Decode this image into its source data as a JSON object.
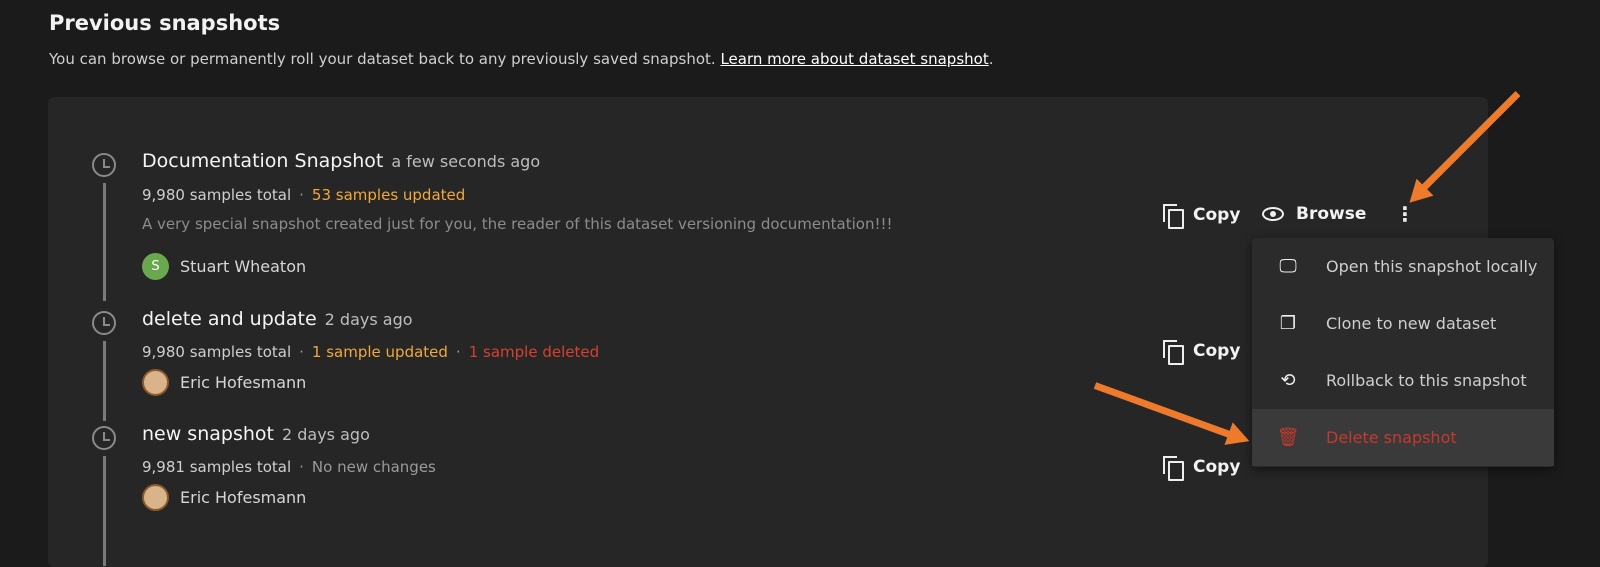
{
  "header": {
    "title": "Previous snapshots",
    "description": "You can browse or permanently roll your dataset back to any previously saved snapshot. ",
    "link": "Learn more about dataset snapshot",
    "period": "."
  },
  "snapshots": [
    {
      "name": "Documentation Snapshot",
      "ago": "a few seconds ago",
      "total": "9,980 samples total",
      "updated": "53 samples updated",
      "description": "A very special snapshot created just for you, the reader of this dataset versioning documentation!!!",
      "user": "Stuart Wheaton",
      "avatar_letter": "S"
    },
    {
      "name": "delete and update",
      "ago": "2 days ago",
      "total": "9,980 samples total",
      "updated": "1 sample updated",
      "deleted": "1 sample deleted",
      "user": "Eric Hofesmann"
    },
    {
      "name": "new snapshot",
      "ago": "2 days ago",
      "total": "9,981 samples total",
      "changes": "No new changes",
      "user": "Eric Hofesmann"
    }
  ],
  "actions": {
    "copy": "Copy",
    "browse": "Browse",
    "more": "⋮"
  },
  "menu": {
    "items": [
      {
        "label": "Open this snapshot locally",
        "icon": "monitor-icon"
      },
      {
        "label": "Clone to new dataset",
        "icon": "copy-icon"
      },
      {
        "label": "Rollback to this snapshot",
        "icon": "rollback-icon"
      },
      {
        "label": "Delete snapshot",
        "icon": "trash-icon"
      }
    ]
  },
  "colors": {
    "updated": "#f0a93a",
    "deleted": "#d6402f",
    "arrow": "#ee7a2c",
    "delete_item": "#c23a2c"
  }
}
